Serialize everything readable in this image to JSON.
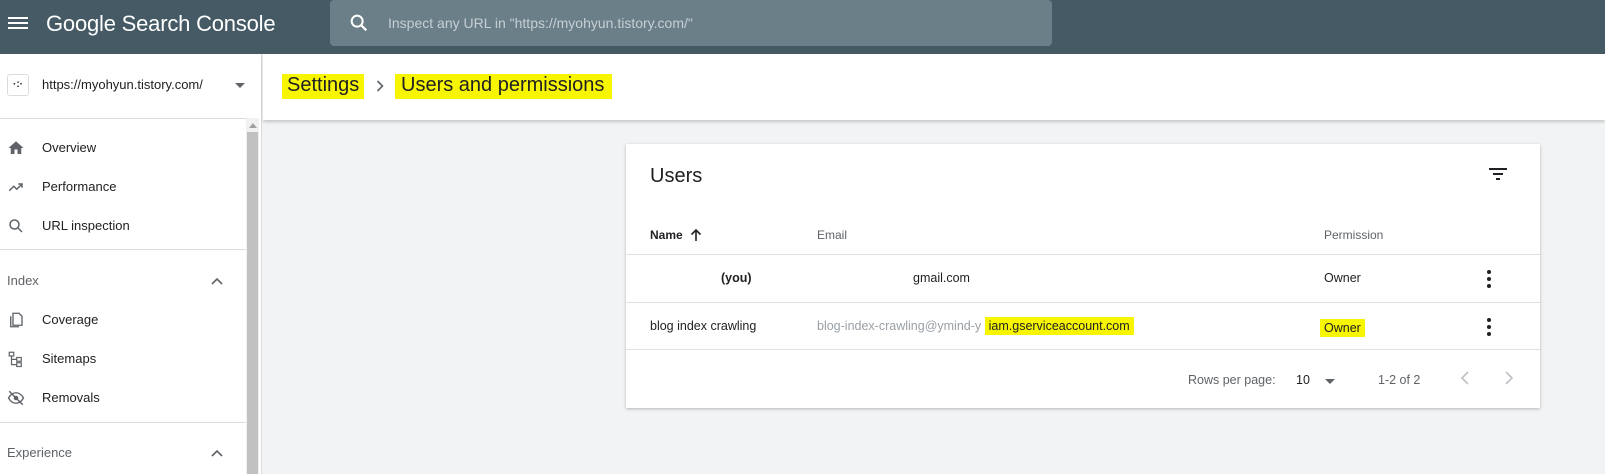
{
  "app": {
    "title": "Google Search Console"
  },
  "search": {
    "placeholder": "Inspect any URL in \"https://myohyun.tistory.com/\""
  },
  "property": {
    "url": "https://myohyun.tistory.com/",
    "icon": "tistory-icon"
  },
  "sidebar": {
    "items": [
      {
        "label": "Overview",
        "icon": "home-icon"
      },
      {
        "label": "Performance",
        "icon": "trending-up-icon"
      },
      {
        "label": "URL inspection",
        "icon": "search-icon"
      }
    ],
    "sections": [
      {
        "label": "Index",
        "items": [
          {
            "label": "Coverage",
            "icon": "pages-icon"
          },
          {
            "label": "Sitemaps",
            "icon": "sitemap-icon"
          },
          {
            "label": "Removals",
            "icon": "visibility-off-icon"
          }
        ]
      },
      {
        "label": "Experience",
        "items": []
      }
    ]
  },
  "breadcrumb": {
    "settings": "Settings",
    "current": "Users and permissions"
  },
  "users_card": {
    "title": "Users",
    "columns": {
      "name": "Name",
      "email": "Email",
      "permission": "Permission"
    },
    "rows": [
      {
        "name": "(you)",
        "email": "gmail.com",
        "permission": "Owner"
      },
      {
        "name": "blog index crawling",
        "email_prefix": "blog-index-crawling@ymind-y",
        "email_domain": "iam.gserviceaccount.com",
        "permission": "Owner"
      }
    ],
    "pagination": {
      "rows_per_page_label": "Rows per page:",
      "rows_per_page": "10",
      "range": "1-2 of 2"
    }
  },
  "colors": {
    "topbar": "#455a64",
    "highlight": "#f7f500",
    "search_bg": "#6b7f88"
  }
}
